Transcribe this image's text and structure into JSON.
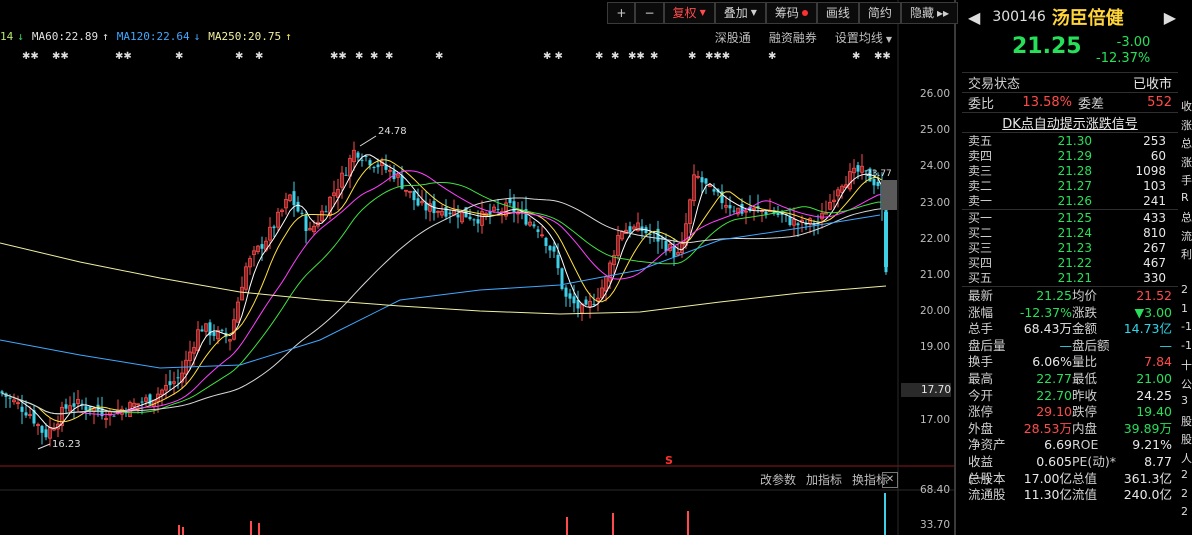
{
  "toolbar": {
    "plus": "+",
    "minus": "−",
    "fq": "复权",
    "dj": "叠加",
    "cm": "筹码",
    "hx": "画线",
    "jy": "简约",
    "yc": "隐藏"
  },
  "ma": {
    "prefix": "14",
    "ma60": "MA60:22.89",
    "ma120": "MA120:22.64",
    "ma250": "MA250:20.75"
  },
  "links": {
    "sgt": "深股通",
    "rzrq": "融资融券",
    "szjx": "设置均线"
  },
  "yaxis": [
    "26.00",
    "25.00",
    "24.00",
    "23.00",
    "22.00",
    "21.00",
    "20.00",
    "19.00",
    "17.00"
  ],
  "crosshair_price": "17.70",
  "annot": {
    "high": "24.78",
    "low": "16.23",
    "s": "S",
    "near": "23.77"
  },
  "vol_axis": [
    "68.40",
    "33.70"
  ],
  "bottom_tabs": [
    "改参数",
    "加指标",
    "换指标"
  ],
  "stock": {
    "code": "300146",
    "name": "汤臣倍健",
    "price": "21.25",
    "change": "-3.00",
    "pct": "-12.37%"
  },
  "status": {
    "label": "交易状态",
    "value": "已收市"
  },
  "wb": {
    "label1": "委比",
    "val1": "13.58%",
    "label2": "委差",
    "val2": "552"
  },
  "dk": "DK点自动提示涨跌信号",
  "asks": [
    {
      "l": "卖五",
      "p": "21.30",
      "v": "253"
    },
    {
      "l": "卖四",
      "p": "21.29",
      "v": "60"
    },
    {
      "l": "卖三",
      "p": "21.28",
      "v": "1098"
    },
    {
      "l": "卖二",
      "p": "21.27",
      "v": "103"
    },
    {
      "l": "卖一",
      "p": "21.26",
      "v": "241"
    }
  ],
  "bids": [
    {
      "l": "买一",
      "p": "21.25",
      "v": "433"
    },
    {
      "l": "买二",
      "p": "21.24",
      "v": "810"
    },
    {
      "l": "买三",
      "p": "21.23",
      "v": "267"
    },
    {
      "l": "买四",
      "p": "21.22",
      "v": "467"
    },
    {
      "l": "买五",
      "p": "21.21",
      "v": "330"
    }
  ],
  "quote": [
    {
      "a": "最新",
      "b": "21.25",
      "c": "均价",
      "d": "21.52"
    },
    {
      "a": "涨幅",
      "b": "-12.37%",
      "c": "涨跌",
      "d": "▼3.00"
    },
    {
      "a": "总手",
      "b": "68.43万",
      "c": "金额",
      "d": "14.73亿"
    },
    {
      "a": "盘后量",
      "b": "—",
      "c": "盘后额",
      "d": "—"
    },
    {
      "a": "换手",
      "b": "6.06%",
      "c": "量比",
      "d": "7.84"
    },
    {
      "a": "最高",
      "b": "22.77",
      "c": "最低",
      "d": "21.00"
    },
    {
      "a": "今开",
      "b": "22.70",
      "c": "昨收",
      "d": "24.25"
    },
    {
      "a": "涨停",
      "b": "29.10",
      "c": "跌停",
      "d": "19.40"
    },
    {
      "a": "外盘",
      "b": "28.53万",
      "c": "内盘",
      "d": "39.89万"
    },
    {
      "a": "净资产",
      "b": "6.69",
      "c": "ROE",
      "d": "9.21%"
    },
    {
      "a": "收益(一)",
      "b": "0.605",
      "c": "PE(动)*",
      "d": "8.77"
    },
    {
      "a": "总股本",
      "b": "17.00亿",
      "c": "总值",
      "d": "361.3亿"
    },
    {
      "a": "流通股",
      "b": "11.30亿",
      "c": "流值",
      "d": "240.0亿"
    }
  ],
  "edge": [
    "收",
    "涨",
    "总",
    "涨",
    "手",
    "R",
    "总",
    "流",
    "利",
    "",
    "2",
    "1",
    "-1",
    "-1",
    "十",
    "公",
    "3",
    "股",
    "股",
    "人",
    "2",
    "2",
    "2"
  ]
}
